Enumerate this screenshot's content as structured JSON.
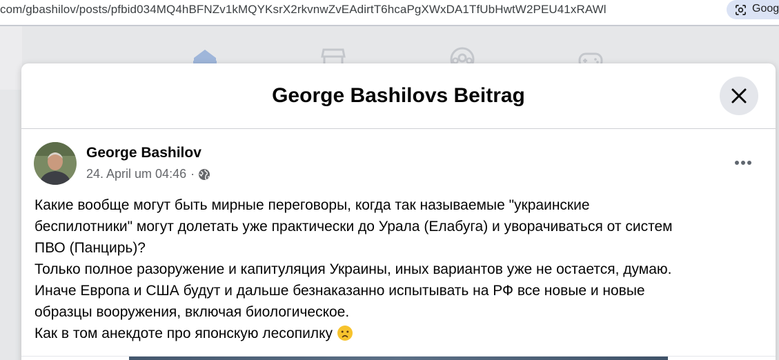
{
  "browser": {
    "url": "com/gbashilov/posts/pfbid034MQ4hBFNZv1kMQYKsrX2rkvnwZvEAdirtT6hcaPgXWxDA1TfUbHwtW2PEU41xRAWl",
    "lens_label": "Goog",
    "lens_icon": "google-lens-icon"
  },
  "nav": {
    "icons": [
      "home-icon",
      "marketplace-icon",
      "groups-icon",
      "gaming-icon"
    ],
    "active": "home-icon"
  },
  "modal": {
    "title": "George Bashilovs Beitrag",
    "close_icon": "close-icon"
  },
  "post": {
    "author": "George Bashilov",
    "date": "24. April um 04:46",
    "separator": "·",
    "privacy_icon": "globe-icon",
    "more_icon": "more-horizontal-icon",
    "lines": [
      "Какие вообще могут быть мирные переговоры, когда так называемые \"украинские",
      "беспилотники\" могут долетать уже практически до Урала (Елабуга) и  уворачиваться от систем",
      "ПВО (Панцирь)?",
      "Только полное разоружение и капитуляция  Украины, иных вариантов уже не остается, думаю.",
      "Иначе Европа и США  будут и дальше безнаказанно испытывать на РФ все новые и новые",
      "образцы вооружения, включая биологическое.",
      "Как в том анекдоте про японскую лесопилку"
    ],
    "emoji": "frowning-face-emoji"
  },
  "colors": {
    "text_primary": "#050505",
    "text_secondary": "#65676b",
    "close_bg": "#e4e6eb",
    "nav_active": "#9fb6da"
  }
}
